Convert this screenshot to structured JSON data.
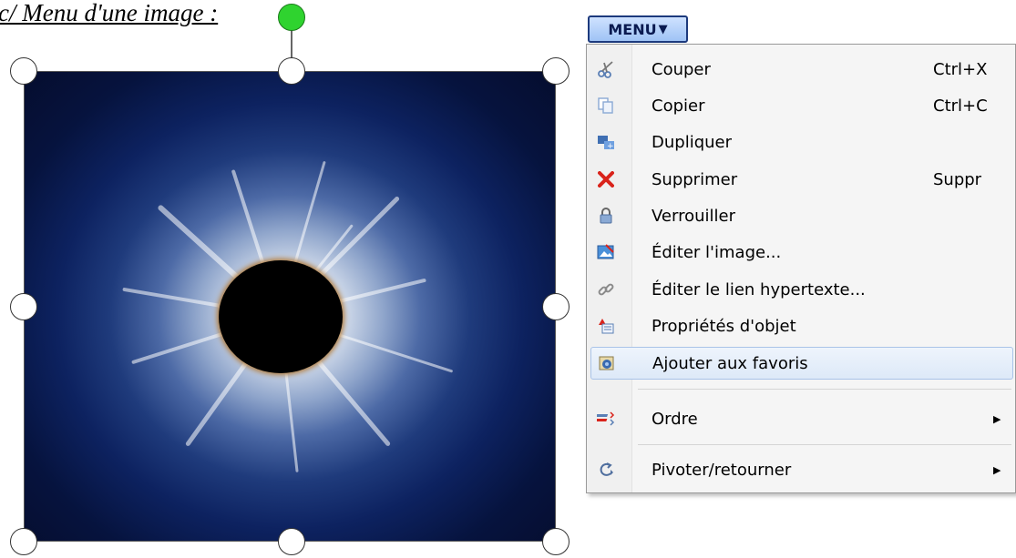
{
  "heading": "c/ Menu d'une image :",
  "menu_button": {
    "label": "MENU"
  },
  "context_menu": {
    "items": [
      {
        "label": "Couper",
        "shortcut": "Ctrl+X",
        "icon": "scissors-icon"
      },
      {
        "label": "Copier",
        "shortcut": "Ctrl+C",
        "icon": "copy-icon"
      },
      {
        "label": "Dupliquer",
        "shortcut": "",
        "icon": "duplicate-icon"
      },
      {
        "label": "Supprimer",
        "shortcut": "Suppr",
        "icon": "delete-x-icon"
      },
      {
        "label": "Verrouiller",
        "shortcut": "",
        "icon": "lock-icon"
      },
      {
        "label": "Éditer l'image...",
        "shortcut": "",
        "icon": "edit-image-icon"
      },
      {
        "label": "Éditer le lien hypertexte...",
        "shortcut": "",
        "icon": "hyperlink-icon"
      },
      {
        "label": "Propriétés d'objet",
        "shortcut": "",
        "icon": "properties-icon"
      },
      {
        "label": "Ajouter aux favoris",
        "shortcut": "",
        "icon": "favorites-icon"
      }
    ],
    "submenus": [
      {
        "label": "Ordre",
        "icon": "order-icon"
      },
      {
        "label": "Pivoter/retourner",
        "icon": "rotate-icon"
      }
    ],
    "highlighted": "Ajouter aux favoris"
  },
  "colors": {
    "menu_button_border": "#1d3a7d",
    "delete_icon": "#d9231b",
    "rotate_handle": "#2fd32f",
    "highlight_bg": "#dde9f8"
  }
}
